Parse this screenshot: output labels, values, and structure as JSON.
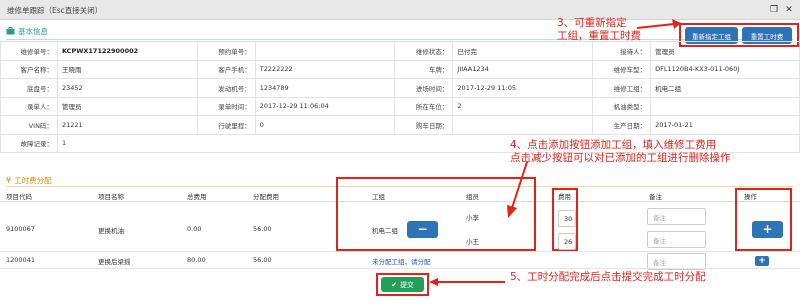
{
  "window": {
    "title": "维修单跟踪（Esc直接关闭）",
    "restore_icon": "restore-icon",
    "close_icon": "close-icon"
  },
  "basic_section": {
    "title": "基本信息",
    "icon": "briefcase-icon"
  },
  "actions": {
    "reassign_label": "重新指定工组",
    "reset_hours_label": "重置工时费"
  },
  "annotations": {
    "a3_line1": "3、可重新指定",
    "a3_line2": "工组，重置工时费",
    "a4_line1": "4、点击添加按钮添加工组，填入维修工费用",
    "a4_line2": "点击减少按钮可以对已添加的工组进行删除操作",
    "a5": "5、工时分配完成后点击提交完成工时分配"
  },
  "info_rows": [
    [
      "维修单号：",
      "KCPWX17122900002",
      "预约单号：",
      "",
      "维修状态：",
      "已付完",
      "接待人：",
      "管理员"
    ],
    [
      "客户名称：",
      "王晓雨",
      "客户手机：",
      "T2222222",
      "车牌：",
      "JIIAA1234",
      "维修车型：",
      "DFL1120B4-KX3-011-060J"
    ],
    [
      "底盘号：",
      "23452",
      "发动机号：",
      "1234789",
      "进场时间：",
      "2017-12-29 11:05",
      "维修工组：",
      "机电二组"
    ],
    [
      "录单人：",
      "管理员",
      "录单时间：",
      "2017-12-29 11:06:04",
      "所在车位：",
      "2",
      "机油类型：",
      ""
    ],
    [
      "VIN码：",
      "21221",
      "行驶里程：",
      "0",
      "购车日期：",
      "",
      "生产日期：",
      "2017-01-21"
    ]
  ],
  "fault": {
    "label": "故障记录：",
    "value": "1"
  },
  "hours_section": {
    "title": "工时费分配",
    "icon": "yen-icon"
  },
  "table": {
    "headers": [
      "项目代码",
      "项目名称",
      "总费用",
      "分配费用",
      "工组",
      "组员",
      "费用",
      "备注",
      "操作"
    ],
    "row1": {
      "code": "9100067",
      "name": "更换机油",
      "total": "0.00",
      "alloc": "56.00",
      "group": "机电二组",
      "members": [
        "小李",
        "小王"
      ],
      "fees": [
        "30",
        "26"
      ],
      "notes_placeholder": "备注",
      "minus": "−",
      "plus": "+"
    },
    "row2": {
      "code": "1200041",
      "name": "更换后梁摇",
      "total": "80.00",
      "alloc": "56.00",
      "group_link": "未分配工组，请分配",
      "notes_placeholder": "备注",
      "plus": "+"
    }
  },
  "submit": {
    "label": "提交",
    "icon": "check-icon"
  }
}
